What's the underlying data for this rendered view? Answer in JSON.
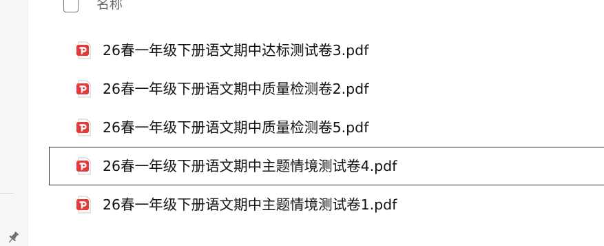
{
  "header": {
    "name_column_label": "名称"
  },
  "files": [
    {
      "name": "26春一年级下册语文期中达标测试卷3.pdf",
      "icon": "pdf-file-icon",
      "focused": false
    },
    {
      "name": "26春一年级下册语文期中质量检测卷2.pdf",
      "icon": "pdf-file-icon",
      "focused": false
    },
    {
      "name": "26春一年级下册语文期中质量检测卷5.pdf",
      "icon": "pdf-file-icon",
      "focused": false
    },
    {
      "name": "26春一年级下册语文期中主题情境测试卷4.pdf",
      "icon": "pdf-file-icon",
      "focused": true
    },
    {
      "name": "26春一年级下册语文期中主题情境测试卷1.pdf",
      "icon": "pdf-file-icon",
      "focused": false
    }
  ],
  "sidebar": {
    "pin_icon": "pin-icon"
  },
  "colors": {
    "pdf_red": "#e5393b",
    "focus_border": "#303030",
    "text": "#111111"
  }
}
